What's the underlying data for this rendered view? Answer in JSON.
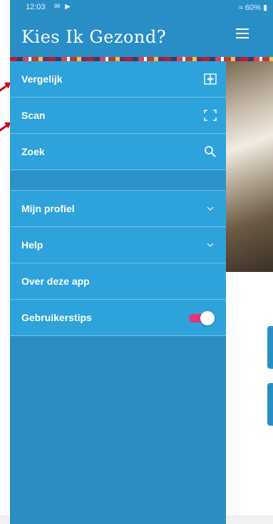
{
  "status_bar": {
    "time": "12:03",
    "battery": "60%"
  },
  "header": {
    "title": "Kies Ik Gezond?"
  },
  "menu": {
    "top_items": [
      {
        "label": "Vergelijk",
        "icon": "compare-icon"
      },
      {
        "label": "Scan",
        "icon": "scan-frame-icon"
      },
      {
        "label": "Zoek",
        "icon": "search-icon"
      }
    ],
    "bottom_items": [
      {
        "label": "Mijn profiel",
        "icon": "chevron-down-icon"
      },
      {
        "label": "Help",
        "icon": "chevron-down-icon"
      },
      {
        "label": "Over deze app"
      },
      {
        "label": "Gebruikerstips",
        "toggle": "on"
      }
    ]
  },
  "colors": {
    "drawer": "#2ea2da",
    "header": "#2a8ec6",
    "toggle_track": "#e3357a"
  }
}
